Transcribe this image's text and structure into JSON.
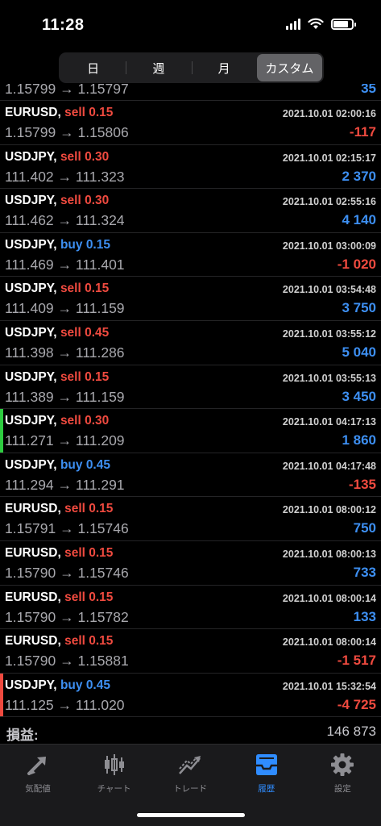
{
  "status_bar": {
    "time": "11:28",
    "battery_level": 0.8
  },
  "segmented": [
    {
      "label": "日",
      "active": false
    },
    {
      "label": "週",
      "active": false
    },
    {
      "label": "月",
      "active": false
    },
    {
      "label": "カスタム",
      "active": true
    }
  ],
  "partial_row": {
    "prices": "1.15799 → 1.15797",
    "profit": "35"
  },
  "trades": [
    {
      "symbol": "EURUSD,",
      "side": "sell",
      "volume": "0.15",
      "date": "2021.10.01 02:00:16",
      "prices": "1.15799 → 1.15806",
      "profit": "-117",
      "profit_sign": "neg",
      "marker": ""
    },
    {
      "symbol": "USDJPY,",
      "side": "sell",
      "volume": "0.30",
      "date": "2021.10.01 02:15:17",
      "prices": "111.402 → 111.323",
      "profit": "2 370",
      "profit_sign": "pos",
      "marker": ""
    },
    {
      "symbol": "USDJPY,",
      "side": "sell",
      "volume": "0.30",
      "date": "2021.10.01 02:55:16",
      "prices": "111.462 → 111.324",
      "profit": "4 140",
      "profit_sign": "pos",
      "marker": ""
    },
    {
      "symbol": "USDJPY,",
      "side": "buy",
      "volume": "0.15",
      "date": "2021.10.01 03:00:09",
      "prices": "111.469 → 111.401",
      "profit": "-1 020",
      "profit_sign": "neg",
      "marker": ""
    },
    {
      "symbol": "USDJPY,",
      "side": "sell",
      "volume": "0.15",
      "date": "2021.10.01 03:54:48",
      "prices": "111.409 → 111.159",
      "profit": "3 750",
      "profit_sign": "pos",
      "marker": ""
    },
    {
      "symbol": "USDJPY,",
      "side": "sell",
      "volume": "0.45",
      "date": "2021.10.01 03:55:12",
      "prices": "111.398 → 111.286",
      "profit": "5 040",
      "profit_sign": "pos",
      "marker": ""
    },
    {
      "symbol": "USDJPY,",
      "side": "sell",
      "volume": "0.15",
      "date": "2021.10.01 03:55:13",
      "prices": "111.389 → 111.159",
      "profit": "3 450",
      "profit_sign": "pos",
      "marker": ""
    },
    {
      "symbol": "USDJPY,",
      "side": "sell",
      "volume": "0.30",
      "date": "2021.10.01 04:17:13",
      "prices": "111.271 → 111.209",
      "profit": "1 860",
      "profit_sign": "pos",
      "marker": "#2ecc40"
    },
    {
      "symbol": "USDJPY,",
      "side": "buy",
      "volume": "0.45",
      "date": "2021.10.01 04:17:48",
      "prices": "111.294 → 111.291",
      "profit": "-135",
      "profit_sign": "neg",
      "marker": ""
    },
    {
      "symbol": "EURUSD,",
      "side": "sell",
      "volume": "0.15",
      "date": "2021.10.01 08:00:12",
      "prices": "1.15791 → 1.15746",
      "profit": "750",
      "profit_sign": "pos",
      "marker": ""
    },
    {
      "symbol": "EURUSD,",
      "side": "sell",
      "volume": "0.15",
      "date": "2021.10.01 08:00:13",
      "prices": "1.15790 → 1.15746",
      "profit": "733",
      "profit_sign": "pos",
      "marker": ""
    },
    {
      "symbol": "EURUSD,",
      "side": "sell",
      "volume": "0.15",
      "date": "2021.10.01 08:00:14",
      "prices": "1.15790 → 1.15782",
      "profit": "133",
      "profit_sign": "pos",
      "marker": ""
    },
    {
      "symbol": "EURUSD,",
      "side": "sell",
      "volume": "0.15",
      "date": "2021.10.01 08:00:14",
      "prices": "1.15790 → 1.15881",
      "profit": "-1 517",
      "profit_sign": "neg",
      "marker": ""
    },
    {
      "symbol": "USDJPY,",
      "side": "buy",
      "volume": "0.45",
      "date": "2021.10.01 15:32:54",
      "prices": "111.125 → 111.020",
      "profit": "-4 725",
      "profit_sign": "neg",
      "marker": "#ef4a3f"
    }
  ],
  "summary": {
    "label": "損益:",
    "value": "146 873"
  },
  "tabbar": [
    {
      "label": "気配値",
      "icon": "quotes-arrows-icon",
      "active": false
    },
    {
      "label": "チャート",
      "icon": "candlestick-chart-icon",
      "active": false
    },
    {
      "label": "トレード",
      "icon": "trade-trend-icon",
      "active": false
    },
    {
      "label": "履歴",
      "icon": "history-inbox-icon",
      "active": true
    },
    {
      "label": "設定",
      "icon": "settings-gear-icon",
      "active": false
    }
  ],
  "colors": {
    "sell": "#ef4a3f",
    "buy": "#3d8ff2",
    "active_tab": "#2f8cff",
    "background": "#000000"
  }
}
